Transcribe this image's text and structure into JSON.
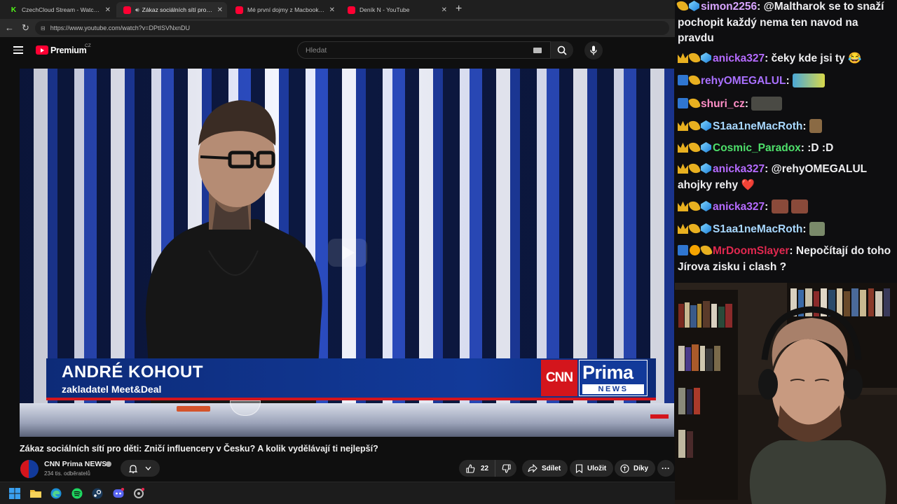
{
  "browser": {
    "tabs": [
      {
        "title": "CzechCloud Stream - Watch Live o",
        "favicon": "kick-icon",
        "active": false
      },
      {
        "title": "Zákaz sociálních sítí pro děti:",
        "favicon": "youtube-icon",
        "active": true,
        "audio": true
      },
      {
        "title": "Mé první dojmy z Macbook Neo.",
        "favicon": "youtube-icon",
        "active": false
      },
      {
        "title": "Deník N - YouTube",
        "favicon": "youtube-icon",
        "active": false
      }
    ],
    "url": "https://www.youtube.com/watch?v=DPtISVNxnDU"
  },
  "youtube": {
    "brand": "Premium",
    "region": "CZ",
    "search_placeholder": "Hledat",
    "video": {
      "title": "Zákaz sociálních sítí pro děti: Zničí influencery v Česku? A kolik vydělávají ti nejlepší?",
      "lower_third_name": "ANDRÉ KOHOUT",
      "lower_third_role": "zakladatel Meet&Deal",
      "logo_cnn": "CNN",
      "logo_prima": "Prima",
      "logo_news": "NEWS"
    },
    "channel": {
      "name": "CNN Prima NEWS",
      "subscribers": "234 tis. odběratelů"
    },
    "actions": {
      "likes": "22",
      "share": "Sdílet",
      "save": "Uložit",
      "thanks": "Díky"
    }
  },
  "chat": {
    "messages": [
      {
        "badges": [
          "pick",
          "gem"
        ],
        "user": "simon2256",
        "color": "#d8a5ff",
        "text": "@Maltharok se to snaží pochopit každý nema ten navod na pravdu"
      },
      {
        "badges": [
          "crown",
          "pick",
          "gem"
        ],
        "user": "anicka327",
        "color": "#b56bff",
        "text": "čeky kde jsi ty 😂"
      },
      {
        "badges": [
          "mod",
          "pick"
        ],
        "user": "rehyOMEGALUL",
        "color": "#a970ff",
        "text": ""
      },
      {
        "badges": [
          "mod",
          "pick"
        ],
        "user": "shuri_cz",
        "color": "#ff8fc7",
        "text": ""
      },
      {
        "badges": [
          "crown",
          "pick",
          "gem"
        ],
        "user": "S1aa1neMacRoth",
        "color": "#a8d8ff",
        "text": ""
      },
      {
        "badges": [
          "crown",
          "pick",
          "gem"
        ],
        "user": "Cosmic_Paradox",
        "color": "#4ee06b",
        "text": ":D :D"
      },
      {
        "badges": [
          "crown",
          "pick",
          "gem"
        ],
        "user": "anicka327",
        "color": "#b56bff",
        "text": "@rehyOMEGALUL ahojky rehy ❤️"
      },
      {
        "badges": [
          "crown",
          "pick",
          "gem"
        ],
        "user": "anicka327",
        "color": "#b56bff",
        "text": ""
      },
      {
        "badges": [
          "crown",
          "pick",
          "gem"
        ],
        "user": "S1aa1neMacRoth",
        "color": "#a8d8ff",
        "text": ""
      },
      {
        "badges": [
          "mod",
          "warn",
          "pick"
        ],
        "user": "MrDoomSlayer",
        "color": "#e0284f",
        "text": "Nepočítají do toho Jírova zisku i clash ?"
      }
    ]
  }
}
